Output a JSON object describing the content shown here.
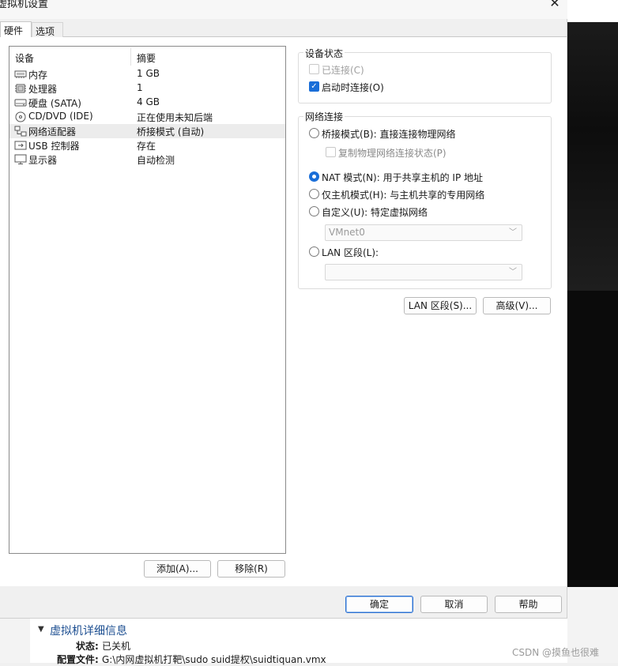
{
  "window": {
    "title": "虚拟机设置",
    "close_glyph": "✕"
  },
  "tabs": [
    {
      "label": "硬件"
    },
    {
      "label": "选项"
    }
  ],
  "device_list": {
    "headers": {
      "device": "设备",
      "summary": "摘要"
    },
    "rows": [
      {
        "name": "内存",
        "summary": "1 GB",
        "icon": "memory-icon"
      },
      {
        "name": "处理器",
        "summary": "1",
        "icon": "processor-icon"
      },
      {
        "name": "硬盘 (SATA)",
        "summary": "4 GB",
        "icon": "hard-disk-icon"
      },
      {
        "name": "CD/DVD (IDE)",
        "summary": "正在使用未知后端",
        "icon": "cd-dvd-icon"
      },
      {
        "name": "网络适配器",
        "summary": "桥接模式 (自动)",
        "icon": "network-adapter-icon",
        "selected": true
      },
      {
        "name": "USB 控制器",
        "summary": "存在",
        "icon": "usb-icon"
      },
      {
        "name": "显示器",
        "summary": "自动检测",
        "icon": "display-icon"
      }
    ],
    "add_button": "添加(A)...",
    "remove_button": "移除(R)"
  },
  "device_status": {
    "legend": "设备状态",
    "connected": {
      "label": "已连接(C)",
      "checked": false,
      "disabled": true
    },
    "connect_at_power_on": {
      "label": "启动时连接(O)",
      "checked": true
    }
  },
  "network_connection": {
    "legend": "网络连接",
    "bridged": {
      "label": "桥接模式(B): 直接连接物理网络",
      "checked": false
    },
    "replicate": {
      "label": "复制物理网络连接状态(P)",
      "checked": false,
      "disabled": true
    },
    "nat": {
      "label": "NAT 模式(N): 用于共享主机的 IP 地址",
      "checked": true
    },
    "host_only": {
      "label": "仅主机模式(H): 与主机共享的专用网络",
      "checked": false
    },
    "custom": {
      "label": "自定义(U): 特定虚拟网络",
      "checked": false
    },
    "custom_select": {
      "value": "VMnet0"
    },
    "lan_segment": {
      "label": "LAN 区段(L):",
      "checked": false
    },
    "lan_select": {
      "value": ""
    }
  },
  "panel_buttons": {
    "lan_segments": "LAN 区段(S)...",
    "advanced": "高级(V)..."
  },
  "dialog_buttons": {
    "ok": "确定",
    "cancel": "取消",
    "help": "帮助"
  },
  "details": {
    "title": "虚拟机详细信息",
    "status_key": "状态:",
    "status_value": "已关机",
    "config_key": "配置文件:",
    "config_value": "G:\\内网虚拟机打靶\\sudo suid提权\\suidtiquan.vmx"
  },
  "watermark": "CSDN @摸鱼也很难",
  "colors": {
    "accent": "#1a6ed8",
    "link_title": "#1d4f91"
  }
}
